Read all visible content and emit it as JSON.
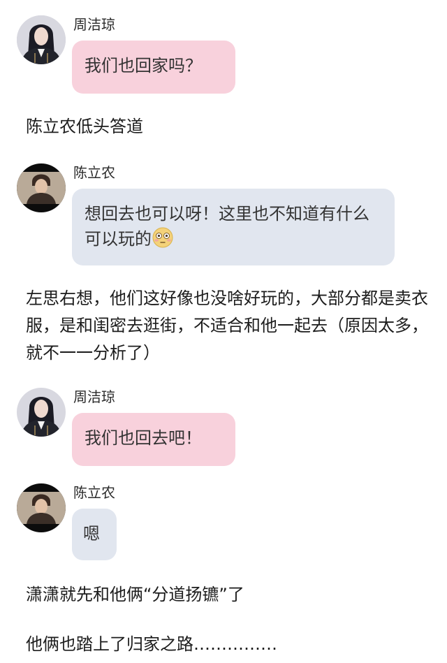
{
  "messages": [
    {
      "sender": "周洁琼",
      "text": "我们也回家吗？",
      "bubble_color": "#f8d1dc"
    },
    {
      "sender": "陈立农",
      "text": "想回去也可以呀！这里也不知道有什么可以玩的",
      "emoji": "flushed-face",
      "bubble_color": "#e1e6ef"
    },
    {
      "sender": "周洁琼",
      "text": "我们也回去吧！",
      "bubble_color": "#f8d1dc"
    },
    {
      "sender": "陈立农",
      "text": "嗯",
      "bubble_color": "#e1e6ef"
    }
  ],
  "narration": [
    "陈立农低头答道",
    "左思右想，他们这好像也没啥好玩的，大部分都是卖衣服，是和闺密去逛街，不适合和他一起去（原因太多，就不一一分析了）",
    "潇潇就先和他俩“分道扬镳”了",
    "他俩也踏上了归家之路……………"
  ]
}
